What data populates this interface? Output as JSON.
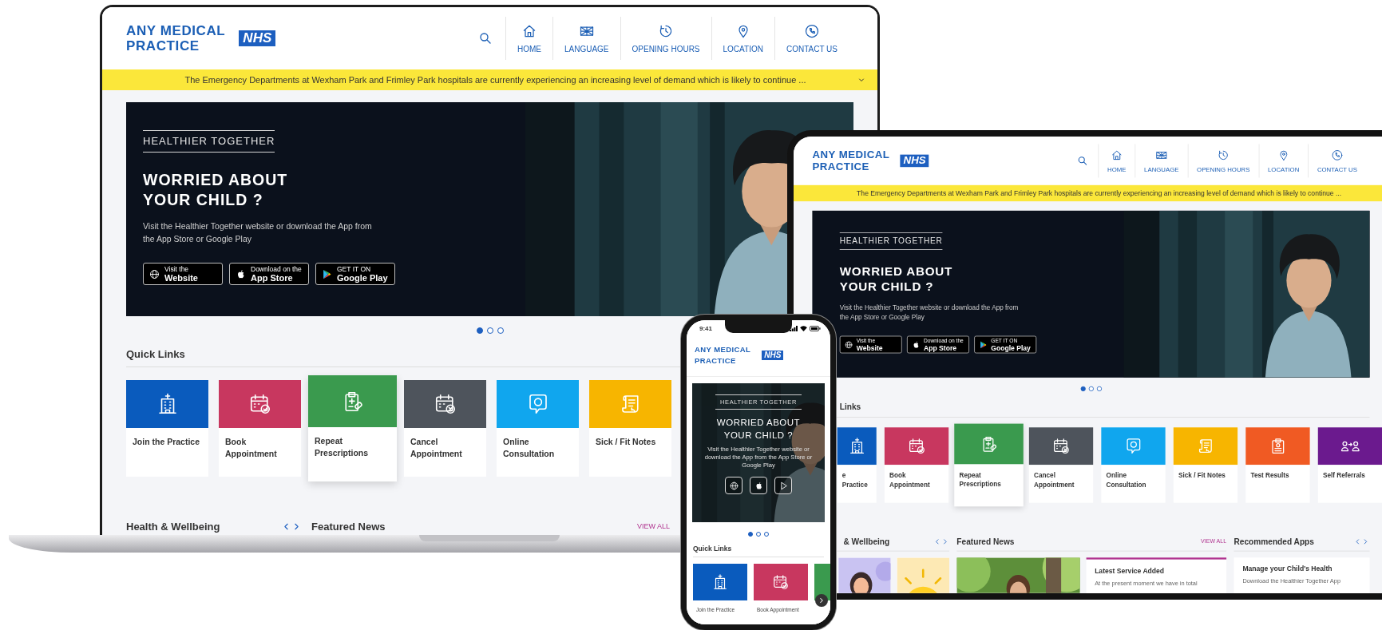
{
  "laptop": {
    "header": {
      "logo": [
        "ANY MEDICAL",
        "PRACTICE"
      ],
      "badge": "NHS",
      "nav": [
        {
          "label": "HOME"
        },
        {
          "label": "LANGUAGE"
        },
        {
          "label": "OPENING HOURS"
        },
        {
          "label": "LOCATION"
        },
        {
          "label": "CONTACT US"
        }
      ]
    },
    "alert": {
      "text": "The Emergency Departments at Wexham Park and Frimley Park hospitals are currently experiencing an increasing level of demand which is likely to continue ...",
      "expanded": false
    },
    "banner": {
      "eyebrow": "HEALTHIER TOGETHER",
      "title": "WORRIED ABOUT YOUR CHILD ?",
      "text": "Visit the Healthier Together website or download the App from the App Store or Google Play",
      "buttons": [
        {
          "kind": "web",
          "small": "Visit the",
          "label": "Website"
        },
        {
          "kind": "apple",
          "small": "Download on the",
          "label": "App Store"
        },
        {
          "kind": "google",
          "small": "GET IT ON",
          "label": "Google Play"
        }
      ]
    },
    "slides": [
      {
        "selected": true
      },
      {
        "selected": false
      },
      {
        "selected": false
      }
    ],
    "quick_links": {
      "title": "Quick Links",
      "tiles": [
        {
          "label": "Join the Practice",
          "color": "#0a5bbd",
          "raised": false
        },
        {
          "label": "Book Appointment",
          "color": "#c8375f",
          "raised": false
        },
        {
          "label": "Repeat Prescriptions",
          "color": "#3a9a4e",
          "raised": true
        },
        {
          "label": "Cancel Appointment",
          "color": "#4e545c",
          "raised": false
        },
        {
          "label": "Online Consultation",
          "color": "#10a6ee",
          "raised": false
        },
        {
          "label": "Sick / Fit Notes",
          "color": "#f7b500",
          "raised": false
        }
      ]
    },
    "sections": [
      {
        "title": "Health & Wellbeing",
        "arrows": true
      },
      {
        "title": "Featured News",
        "link": "VIEW ALL"
      }
    ]
  },
  "tablet": {
    "header": {
      "logo": [
        "ANY MEDICAL",
        "PRACTICE"
      ],
      "badge": "NHS",
      "nav": [
        {
          "label": "HOME"
        },
        {
          "label": "LANGUAGE"
        },
        {
          "label": "OPENING HOURS"
        },
        {
          "label": "LOCATION"
        },
        {
          "label": "CONTACT US"
        }
      ]
    },
    "alert": {
      "text": "The Emergency Departments at Wexham Park and Frimley Park hospitals are currently experiencing an increasing level of demand which is likely to continue ..."
    },
    "banner": {
      "eyebrow": "HEALTHIER TOGETHER",
      "title": "WORRIED ABOUT YOUR CHILD ?",
      "text": "Visit the Healthier Together website or download the App from the App Store or Google Play",
      "buttons": [
        {
          "kind": "web",
          "small": "Visit the",
          "label": "Website"
        },
        {
          "kind": "apple",
          "small": "Download on the",
          "label": "App Store"
        },
        {
          "kind": "google",
          "small": "GET IT ON",
          "label": "Google Play"
        }
      ]
    },
    "slides": [
      {
        "selected": true
      },
      {
        "selected": false
      },
      {
        "selected": false
      }
    ],
    "quick_links": {
      "title": "Links",
      "tiles": [
        {
          "label": "e Practice",
          "color": "#0a5bbd",
          "raised": false
        },
        {
          "label": "Book Appointment",
          "color": "#c8375f",
          "raised": false
        },
        {
          "label": "Repeat Prescriptions",
          "color": "#3a9a4e",
          "raised": true
        },
        {
          "label": "Cancel Appointment",
          "color": "#4e545c",
          "raised": false
        },
        {
          "label": "Online Consultation",
          "color": "#10a6ee",
          "raised": false
        },
        {
          "label": "Sick / Fit Notes",
          "color": "#f7b500",
          "raised": false
        },
        {
          "label": "Test Results",
          "color": "#f05a23",
          "raised": false
        },
        {
          "label": "Self Referrals",
          "color": "#6b1a8e",
          "raised": false
        }
      ]
    },
    "sections": [
      {
        "title": "& Wellbeing",
        "arrows": true,
        "cards": [
          {
            "kind": "picture"
          },
          {
            "kind": "picture"
          }
        ]
      },
      {
        "title": "Featured News",
        "link": "VIEW ALL",
        "cards": [
          {
            "kind": "picture"
          },
          {
            "kind": "article",
            "accent": true,
            "title": "Latest Service Added",
            "text": "At the present moment we have in total"
          }
        ]
      },
      {
        "title": "Recommended Apps",
        "arrows": true,
        "cards": [
          {
            "kind": "article",
            "accent": false,
            "title": "Manage your Child's Health",
            "text": "Download the Healthier Together App"
          }
        ]
      }
    ]
  },
  "phone": {
    "status_time": "9:41",
    "header": {
      "logo": [
        "ANY MEDICAL",
        "PRACTICE"
      ],
      "badge": "NHS"
    },
    "banner": {
      "eyebrow": "HEALTHIER TOGETHER",
      "title": "WORRIED ABOUT YOUR CHILD ?",
      "text": "Visit the Healthier Together website or download the App from the App Store or Google Play",
      "buttons": [
        {
          "kind": "web"
        },
        {
          "kind": "apple"
        },
        {
          "kind": "google"
        }
      ]
    },
    "slides": [
      {
        "selected": true
      },
      {
        "selected": false
      },
      {
        "selected": false
      }
    ],
    "quick_links": {
      "title": "Quick Links",
      "tiles": [
        {
          "label": "Join the Practice",
          "color": "#0a5bbd"
        },
        {
          "label": "Book Appointment",
          "color": "#c8375f"
        },
        {
          "color": "#3a9a4e"
        }
      ]
    }
  }
}
